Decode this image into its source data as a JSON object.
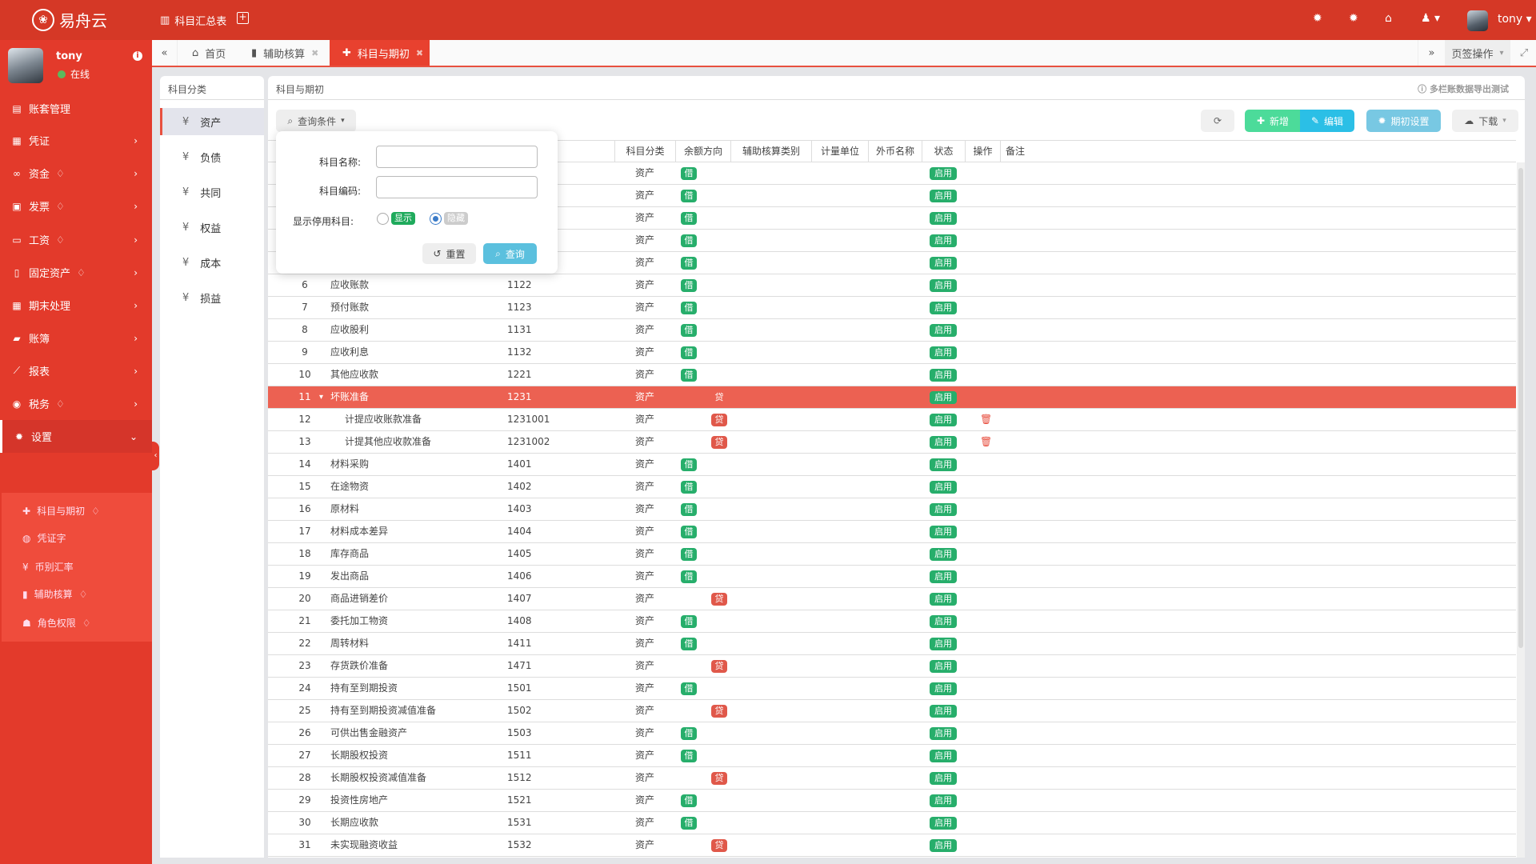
{
  "header": {
    "brand": "易舟云",
    "quick_link": "科目汇总表",
    "user": "tony",
    "icons": [
      "bug-icon",
      "bug-icon",
      "home-icon",
      "user-icon",
      "avatar"
    ]
  },
  "user_panel": {
    "name": "tony",
    "status": "在线"
  },
  "sidebar": {
    "items": [
      {
        "label": "账套管理",
        "icon": "archive-icon",
        "premium": false,
        "chevron": false
      },
      {
        "label": "凭证",
        "icon": "voucher-icon",
        "premium": false,
        "chevron": true
      },
      {
        "label": "资金",
        "icon": "link-icon",
        "premium": true,
        "chevron": true
      },
      {
        "label": "发票",
        "icon": "invoice-icon",
        "premium": true,
        "chevron": true
      },
      {
        "label": "工资",
        "icon": "credit-card-icon",
        "premium": true,
        "chevron": true
      },
      {
        "label": "固定资产",
        "icon": "building-icon",
        "premium": true,
        "chevron": true
      },
      {
        "label": "期末处理",
        "icon": "calendar-icon",
        "premium": false,
        "chevron": true
      },
      {
        "label": "账簿",
        "icon": "book-icon",
        "premium": false,
        "chevron": true
      },
      {
        "label": "报表",
        "icon": "line-chart-icon",
        "premium": false,
        "chevron": true
      },
      {
        "label": "税务",
        "icon": "compass-icon",
        "premium": true,
        "chevron": true
      },
      {
        "label": "设置",
        "icon": "gear-icon",
        "premium": false,
        "chevron": true,
        "expanded": true
      }
    ],
    "submenu": [
      {
        "label": "科目与期初",
        "icon": "puzzle-icon",
        "premium": true,
        "active": true
      },
      {
        "label": "凭证字",
        "icon": "stamp-icon",
        "premium": false
      },
      {
        "label": "币别汇率",
        "icon": "yen-icon",
        "premium": false
      },
      {
        "label": "辅助核算",
        "icon": "folder-icon",
        "premium": true
      },
      {
        "label": "角色权限",
        "icon": "users-icon",
        "premium": true
      }
    ]
  },
  "tabs": {
    "items": [
      {
        "label": "首页",
        "icon": "home-icon",
        "closable": false
      },
      {
        "label": "辅助核算",
        "icon": "folder-icon",
        "closable": true
      },
      {
        "label": "科目与期初",
        "icon": "puzzle-icon",
        "closable": true,
        "active": true
      }
    ],
    "page_ops": "页签操作"
  },
  "categories": {
    "title": "科目分类",
    "items": [
      "资产",
      "负债",
      "共同",
      "权益",
      "成本",
      "损益"
    ],
    "active": "资产",
    "symbol": "¥"
  },
  "main": {
    "title": "科目与期初",
    "hint": "多栏账数据导出测试",
    "toolbar": {
      "query": "查询条件",
      "add": "新增",
      "edit": "编辑",
      "period_settings": "期初设置",
      "download": "下载"
    },
    "columns": [
      "科目分类",
      "余额方向",
      "辅助核算类别",
      "计量单位",
      "外币名称",
      "状态",
      "操作",
      "备注"
    ],
    "rows": [
      {
        "cat": "资产",
        "dir": "借",
        "status": "启用"
      },
      {
        "cat": "资产",
        "dir": "借",
        "status": "启用"
      },
      {
        "cat": "资产",
        "dir": "借",
        "status": "启用"
      },
      {
        "cat": "资产",
        "dir": "借",
        "status": "启用"
      },
      {
        "cat": "资产",
        "dir": "借",
        "status": "启用"
      },
      {
        "idx": "6",
        "name": "应收账款",
        "code": "1122",
        "cat": "资产",
        "dir": "借",
        "status": "启用"
      },
      {
        "idx": "7",
        "name": "预付账款",
        "code": "1123",
        "cat": "资产",
        "dir": "借",
        "status": "启用"
      },
      {
        "idx": "8",
        "name": "应收股利",
        "code": "1131",
        "cat": "资产",
        "dir": "借",
        "status": "启用"
      },
      {
        "idx": "9",
        "name": "应收利息",
        "code": "1132",
        "cat": "资产",
        "dir": "借",
        "status": "启用"
      },
      {
        "idx": "10",
        "name": "其他应收款",
        "code": "1221",
        "cat": "资产",
        "dir": "借",
        "status": "启用"
      },
      {
        "idx": "11",
        "name": "坏账准备",
        "code": "1231",
        "cat": "资产",
        "dir": "贷",
        "status": "启用",
        "selected": true,
        "expanded": true
      },
      {
        "idx": "12",
        "name": "计提应收账款准备",
        "code": "1231001",
        "cat": "资产",
        "dir": "贷",
        "status": "启用",
        "child": true,
        "deletable": true
      },
      {
        "idx": "13",
        "name": "计提其他应收款准备",
        "code": "1231002",
        "cat": "资产",
        "dir": "贷",
        "status": "启用",
        "child": true,
        "deletable": true
      },
      {
        "idx": "14",
        "name": "材料采购",
        "code": "1401",
        "cat": "资产",
        "dir": "借",
        "status": "启用"
      },
      {
        "idx": "15",
        "name": "在途物资",
        "code": "1402",
        "cat": "资产",
        "dir": "借",
        "status": "启用"
      },
      {
        "idx": "16",
        "name": "原材料",
        "code": "1403",
        "cat": "资产",
        "dir": "借",
        "status": "启用"
      },
      {
        "idx": "17",
        "name": "材料成本差异",
        "code": "1404",
        "cat": "资产",
        "dir": "借",
        "status": "启用"
      },
      {
        "idx": "18",
        "name": "库存商品",
        "code": "1405",
        "cat": "资产",
        "dir": "借",
        "status": "启用"
      },
      {
        "idx": "19",
        "name": "发出商品",
        "code": "1406",
        "cat": "资产",
        "dir": "借",
        "status": "启用"
      },
      {
        "idx": "20",
        "name": "商品进销差价",
        "code": "1407",
        "cat": "资产",
        "dir": "贷",
        "status": "启用"
      },
      {
        "idx": "21",
        "name": "委托加工物资",
        "code": "1408",
        "cat": "资产",
        "dir": "借",
        "status": "启用"
      },
      {
        "idx": "22",
        "name": "周转材料",
        "code": "1411",
        "cat": "资产",
        "dir": "借",
        "status": "启用"
      },
      {
        "idx": "23",
        "name": "存货跌价准备",
        "code": "1471",
        "cat": "资产",
        "dir": "贷",
        "status": "启用"
      },
      {
        "idx": "24",
        "name": "持有至到期投资",
        "code": "1501",
        "cat": "资产",
        "dir": "借",
        "status": "启用"
      },
      {
        "idx": "25",
        "name": "持有至到期投资减值准备",
        "code": "1502",
        "cat": "资产",
        "dir": "贷",
        "status": "启用"
      },
      {
        "idx": "26",
        "name": "可供出售金融资产",
        "code": "1503",
        "cat": "资产",
        "dir": "借",
        "status": "启用"
      },
      {
        "idx": "27",
        "name": "长期股权投资",
        "code": "1511",
        "cat": "资产",
        "dir": "借",
        "status": "启用"
      },
      {
        "idx": "28",
        "name": "长期股权投资减值准备",
        "code": "1512",
        "cat": "资产",
        "dir": "贷",
        "status": "启用"
      },
      {
        "idx": "29",
        "name": "投资性房地产",
        "code": "1521",
        "cat": "资产",
        "dir": "借",
        "status": "启用"
      },
      {
        "idx": "30",
        "name": "长期应收款",
        "code": "1531",
        "cat": "资产",
        "dir": "借",
        "status": "启用"
      },
      {
        "idx": "31",
        "name": "未实现融资收益",
        "code": "1532",
        "cat": "资产",
        "dir": "贷",
        "status": "启用"
      }
    ]
  },
  "query_popup": {
    "name_label": "科目名称:",
    "name_value": "",
    "code_label": "科目编码:",
    "code_value": "",
    "show_disabled_label": "显示停用科目:",
    "option_show": "显示",
    "option_hide": "隐藏",
    "selected": "隐藏",
    "reset": "重置",
    "search": "查询"
  },
  "colors": {
    "header": "#d53826",
    "sidebar": "#e33a2b",
    "debit": "#27ae6b",
    "credit": "#e0584a",
    "selected_row": "#ec6152",
    "add": "#4cdb9a",
    "edit": "#2bbfe6",
    "period": "#78c8e3"
  }
}
